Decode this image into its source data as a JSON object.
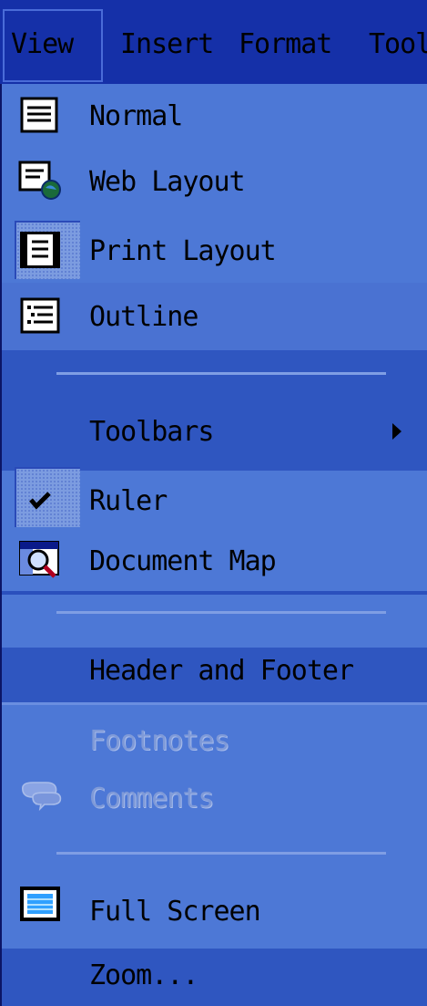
{
  "menubar": {
    "items": [
      "View",
      "Insert",
      "Format",
      "Tool"
    ]
  },
  "menu": {
    "normal": "Normal",
    "web_layout": "Web Layout",
    "print_layout": "Print Layout",
    "outline": "Outline",
    "toolbars": "Toolbars",
    "ruler": "Ruler",
    "document_map": "Document Map",
    "header_footer": "Header and Footer",
    "footnotes": "Footnotes",
    "comments": "Comments",
    "full_screen": "Full Screen",
    "zoom": "Zoom..."
  }
}
